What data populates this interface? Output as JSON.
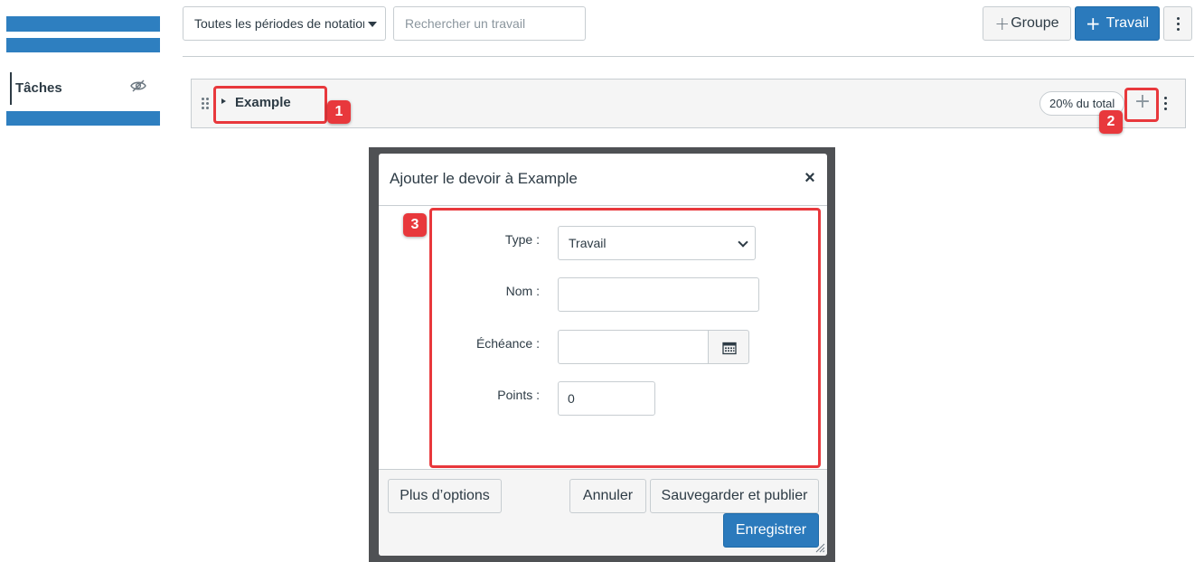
{
  "sidebar": {
    "nav_label": "Tâches",
    "hidden_icon": "eye-slash-icon"
  },
  "toolbar": {
    "grading_period": "Toutes les périodes de notation",
    "search_placeholder": "Rechercher un travail",
    "add_group_label": "Groupe",
    "add_assignment_label": "Travail"
  },
  "group": {
    "name": "Example",
    "weight": "20% du total"
  },
  "callouts": [
    "1",
    "2",
    "3"
  ],
  "dialog": {
    "title": "Ajouter le devoir à Example",
    "close_glyph": "×",
    "form": {
      "type_label": "Type :",
      "type_value": "Travail",
      "name_label": "Nom :",
      "name_value": "",
      "due_label": "Échéance :",
      "due_value": "",
      "points_label": "Points :",
      "points_value": "0"
    },
    "buttons": {
      "more_options": "Plus d’options",
      "cancel": "Annuler",
      "save_publish": "Sauvegarder et publier",
      "save": "Enregistrer"
    }
  },
  "colors": {
    "brand_blue": "#2b7abc",
    "callout_red": "#e8383c",
    "text": "#2d3b45",
    "border": "#c7cdd1"
  }
}
